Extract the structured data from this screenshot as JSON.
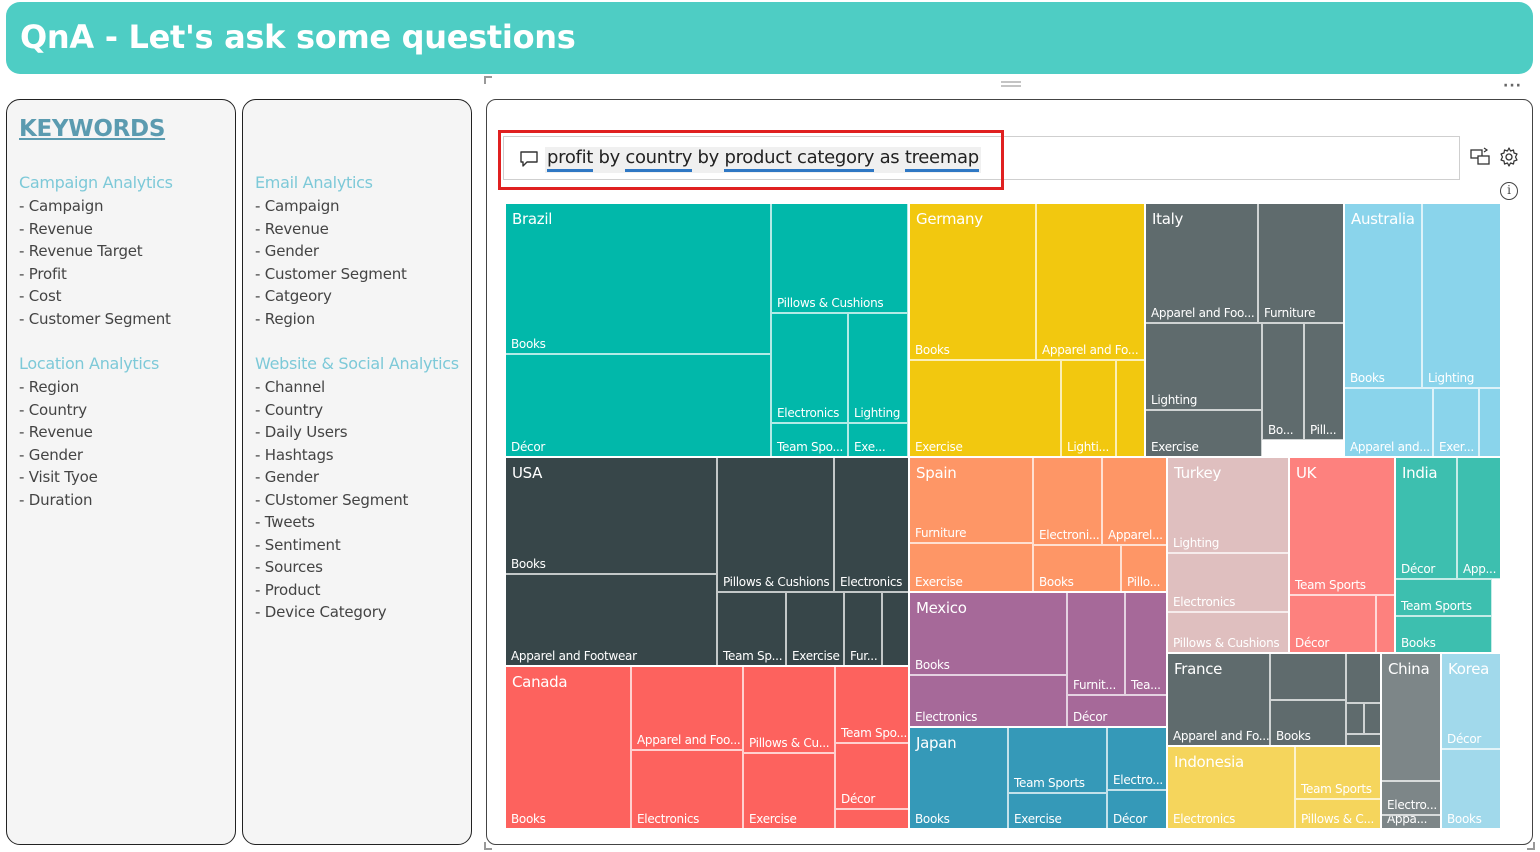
{
  "header": {
    "title": "QnA - Let's ask some questions"
  },
  "keywords_title": "KEYWORDS",
  "sections": {
    "campaign": {
      "title": "Campaign Analytics",
      "items": [
        "- Campaign",
        "- Revenue",
        "- Revenue Target",
        "- Profit",
        "- Cost",
        "- Customer Segment"
      ]
    },
    "location": {
      "title": "Location Analytics",
      "items": [
        "- Region",
        "- Country",
        "- Revenue",
        "- Gender",
        "- Visit Tyoe",
        "- Duration"
      ]
    },
    "email": {
      "title": "Email Analytics",
      "items": [
        "- Campaign",
        "- Revenue",
        "- Gender",
        "- Customer Segment",
        "- Catgeory",
        "- Region"
      ]
    },
    "website": {
      "title": "Website & Social Analytics",
      "items": [
        "- Channel",
        "- Country",
        "- Daily Users",
        "- Hashtags",
        "- Gender",
        "- CUstomer Segment",
        "- Tweets",
        "- Sentiment",
        "- Sources",
        "- Product",
        "- Device Category"
      ]
    }
  },
  "qna": {
    "query_tokens": [
      "profit",
      "by",
      "country",
      "by",
      "product category",
      "as",
      "treemap"
    ],
    "icons": {
      "chat": "chat-icon",
      "convert": "convert-to-visual-icon",
      "settings": "gear-icon",
      "info": "info-icon",
      "more": "more-options-icon"
    },
    "info_glyph": "i",
    "more_glyph": "···"
  },
  "chart_data": {
    "type": "treemap",
    "title": "",
    "groups": [
      {
        "name": "Brazil",
        "color": "#01b8aa",
        "cells": [
          "Books",
          "Pillows & Cushions",
          "Décor",
          "Electronics",
          "Lighting",
          "Team Spo...",
          "Exe..."
        ]
      },
      {
        "name": "Germany",
        "color": "#f2c80f",
        "cells": [
          "Books",
          "Apparel and Fo...",
          "Exercise",
          "Lighti..."
        ]
      },
      {
        "name": "Italy",
        "color": "#5f6b6d",
        "cells": [
          "Apparel and Foo...",
          "Furniture",
          "Lighting",
          "Bo...",
          "Pill...",
          "Exercise"
        ]
      },
      {
        "name": "Australia",
        "color": "#8ad4eb",
        "cells": [
          "Books",
          "Lighting",
          "Apparel and...",
          "Exer..."
        ]
      },
      {
        "name": "USA",
        "color": "#374649",
        "cells": [
          "Books",
          "Pillows & Cushions",
          "Electronics",
          "Apparel and Footwear",
          "Team Sp...",
          "Exercise",
          "Fur..."
        ]
      },
      {
        "name": "Spain",
        "color": "#fe9666",
        "cells": [
          "Furniture",
          "Electroni...",
          "Apparel...",
          "Pillo...",
          "Exercise",
          "Books"
        ]
      },
      {
        "name": "Turkey",
        "color": "#dfbfbf",
        "cells": [
          "Lighting",
          "Electronics",
          "Pillows & Cushions"
        ]
      },
      {
        "name": "UK",
        "color": "#fd817e",
        "cells": [
          "Team Sports",
          "Décor"
        ]
      },
      {
        "name": "India",
        "color": "#3dbfaf",
        "cells": [
          "Décor",
          "App...",
          "Team Sports",
          "Books"
        ]
      },
      {
        "name": "Mexico",
        "color": "#a66999",
        "cells": [
          "Books",
          "Furnit...",
          "Tea...",
          "Electronics",
          "Décor"
        ]
      },
      {
        "name": "France",
        "color": "#5f6b6d",
        "cells": [
          "Apparel and Fo...",
          "Books"
        ]
      },
      {
        "name": "China",
        "color": "#7d8688",
        "cells": [
          "Electro...",
          "Appa..."
        ]
      },
      {
        "name": "Korea",
        "color": "#a1d9eb",
        "cells": [
          "Décor",
          "Books"
        ]
      },
      {
        "name": "Canada",
        "color": "#fd625e",
        "cells": [
          "Apparel and Foo...",
          "Pillows & Cu...",
          "Team Spo...",
          "Décor",
          "Books",
          "Electronics",
          "Exercise"
        ]
      },
      {
        "name": "Japan",
        "color": "#3599b8",
        "cells": [
          "Team Sports",
          "Electro...",
          "Books",
          "Exercise",
          "Décor"
        ]
      },
      {
        "name": "Indonesia",
        "color": "#f5d55c",
        "cells": [
          "Team Sports",
          "Electronics",
          "Pillows & C..."
        ]
      }
    ]
  }
}
